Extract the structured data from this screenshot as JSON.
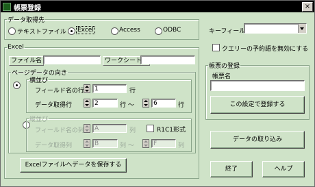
{
  "window": {
    "title": "帳票登録",
    "close_symbol": "×"
  },
  "data_source": {
    "label": "データ取得先",
    "options": [
      "テキストファイル",
      "Excel",
      "Access",
      "ODBC"
    ],
    "selected": "Excel"
  },
  "excel": {
    "label": "Excel",
    "file_name_label": "ファイル名",
    "file_name_value": "",
    "sheet_name_label": "ワークシート名",
    "sheet_name_value": "",
    "orientation": {
      "label": "ページデータの向き",
      "horizontal": {
        "label": "横並び",
        "selected": true,
        "field_row_label": "フィールド名の行",
        "field_row_value": "1",
        "field_row_unit": "行",
        "data_rows_label": "データ取得行",
        "data_from": "2",
        "range_sep": "行 ～",
        "data_to": "6",
        "data_unit": "行"
      },
      "vertical": {
        "label": "縦並び",
        "selected": false,
        "field_col_label": "フィールド名の列",
        "field_col_value": "A",
        "field_col_unit": "列",
        "r1c1_label": "R1C1形式",
        "r1c1_checked": false,
        "data_cols_label": "データ取得列",
        "data_from": "B",
        "range_sep": "列 ～",
        "data_to": "F",
        "data_unit": "列"
      }
    },
    "save_button": "Excelファイルへデータを保存する"
  },
  "keyfield": {
    "label": "キーフィールド",
    "value": ""
  },
  "disable_reserved": {
    "label": "クエリーの予約語を無効にする",
    "checked": false
  },
  "registration": {
    "label": "帳票の登録",
    "name_label": "帳票名",
    "name_value": "",
    "register_button": "この設定で登録する"
  },
  "import_button": "データの取り込み",
  "exit_button": "終了",
  "help_button": "ヘルプ"
}
